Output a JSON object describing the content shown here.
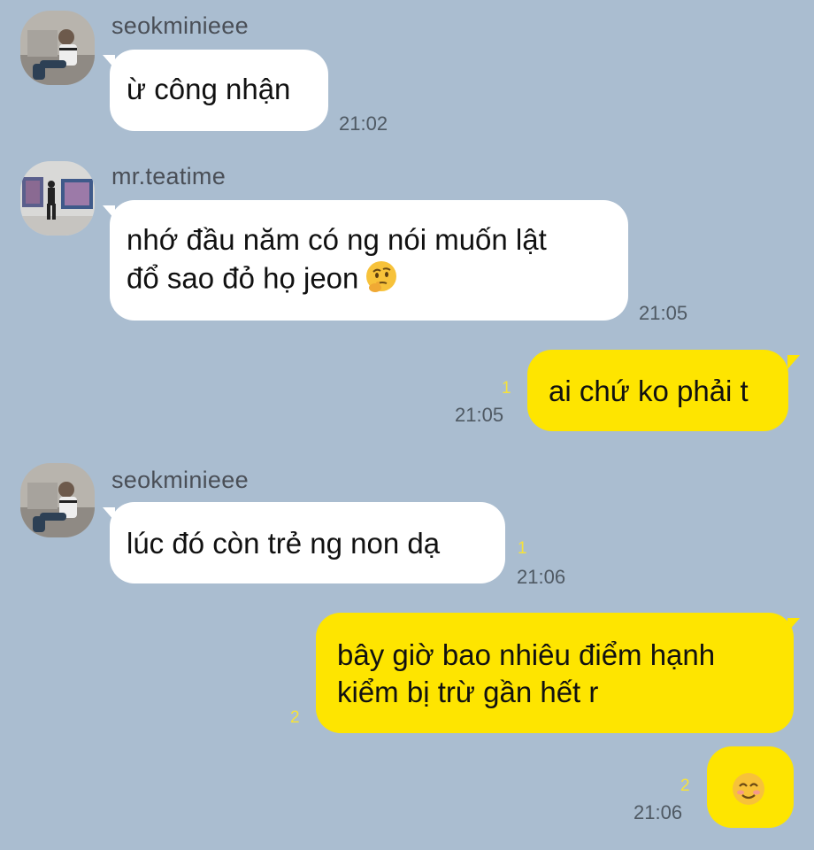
{
  "colors": {
    "background": "#aabdd0",
    "incoming_bubble": "#ffffff",
    "outgoing_bubble": "#fee500",
    "unread_count": "#f6e23a",
    "timestamp": "#4f5963"
  },
  "messages": [
    {
      "id": "m1",
      "direction": "incoming",
      "sender": "seokminieee",
      "avatar_icon": "profile-photo-person-sitting",
      "text": "ừ công nhận",
      "time": "21:02"
    },
    {
      "id": "m2",
      "direction": "incoming",
      "sender": "mr.teatime",
      "avatar_icon": "profile-photo-gallery",
      "text_line1": "nhớ đầu năm có ng nói muốn lật",
      "text_line2": "đổ sao đỏ họ jeon",
      "emoji": "thinking-face-emoji",
      "time": "21:05"
    },
    {
      "id": "m3",
      "direction": "outgoing",
      "text": "ai chứ ko phải t",
      "unread": "1",
      "time": "21:05"
    },
    {
      "id": "m4",
      "direction": "incoming",
      "sender": "seokminieee",
      "avatar_icon": "profile-photo-person-sitting",
      "text": "lúc đó còn trẻ ng non dạ",
      "unread": "1",
      "time": "21:06"
    },
    {
      "id": "m5",
      "direction": "outgoing",
      "text_line1": "bây giờ bao nhiêu điểm hạnh",
      "text_line2": "kiểm bị trừ gần hết r",
      "unread": "2"
    },
    {
      "id": "m6",
      "direction": "outgoing",
      "emoji": "smiling-face-emoji",
      "unread": "2",
      "time": "21:06"
    }
  ]
}
